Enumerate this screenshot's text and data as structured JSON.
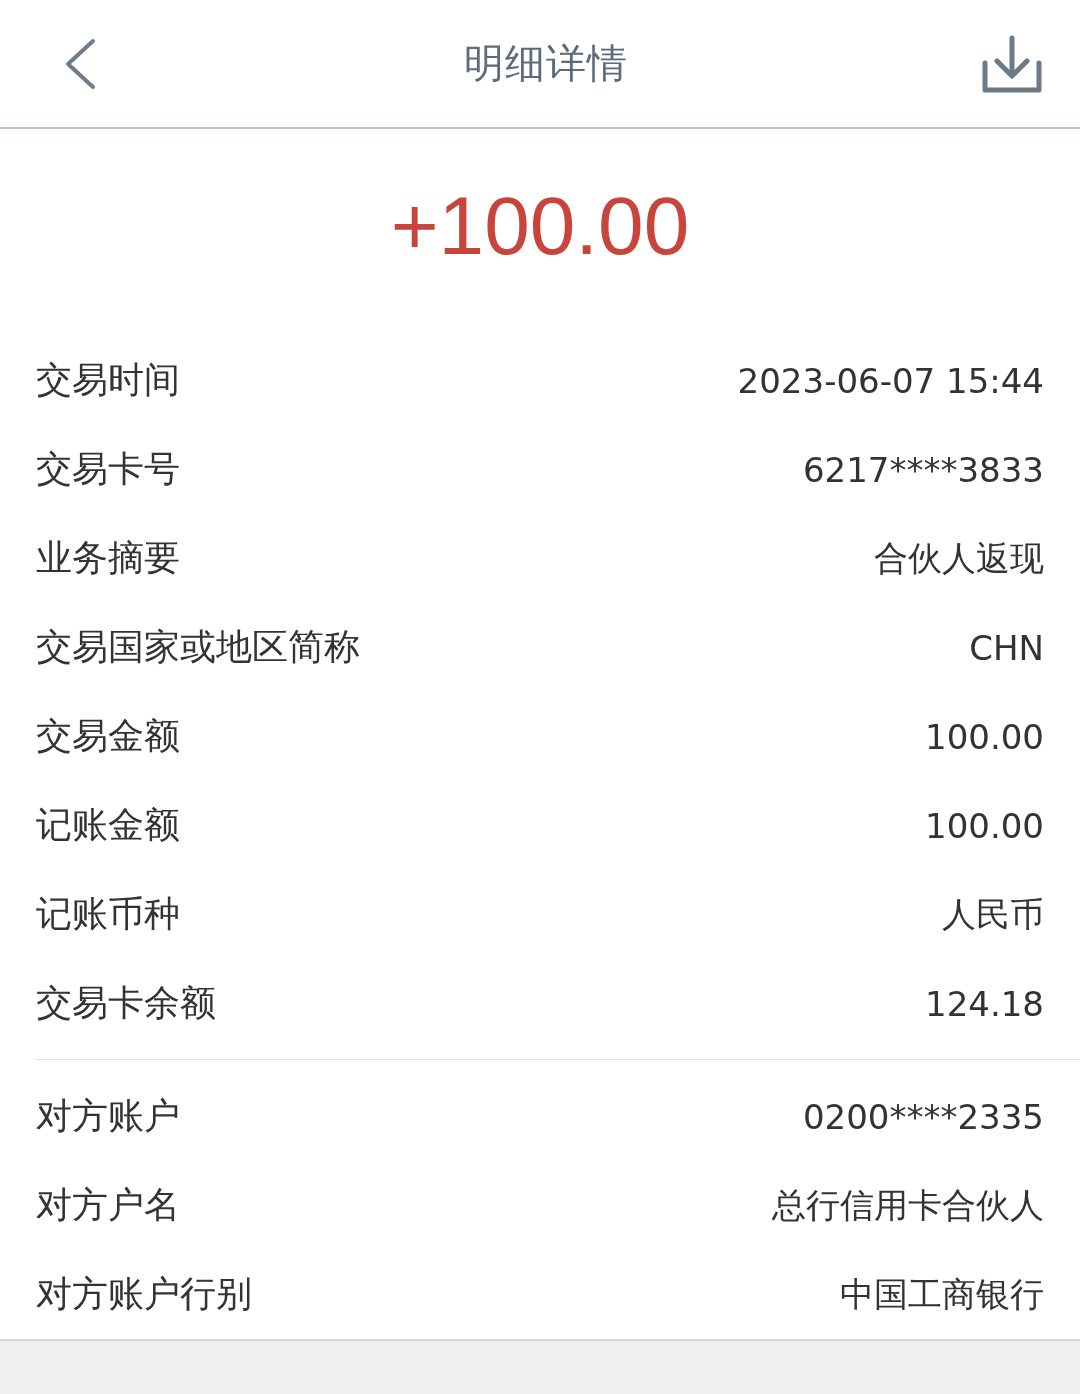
{
  "header": {
    "title": "明细详情"
  },
  "amount": "+100.00",
  "sections": [
    {
      "rows": [
        {
          "label": "交易时间",
          "value": "2023-06-07 15:44"
        },
        {
          "label": "交易卡号",
          "value": "6217****3833"
        },
        {
          "label": "业务摘要",
          "value": "合伙人返现"
        },
        {
          "label": "交易国家或地区简称",
          "value": "CHN"
        },
        {
          "label": "交易金额",
          "value": "100.00"
        },
        {
          "label": "记账金额",
          "value": "100.00"
        },
        {
          "label": "记账币种",
          "value": "人民币"
        },
        {
          "label": "交易卡余额",
          "value": "124.18"
        }
      ]
    },
    {
      "rows": [
        {
          "label": "对方账户",
          "value": "0200****2335"
        },
        {
          "label": "对方户名",
          "value": "总行信用卡合伙人"
        },
        {
          "label": "对方账户行别",
          "value": "中国工商银行"
        }
      ]
    }
  ]
}
